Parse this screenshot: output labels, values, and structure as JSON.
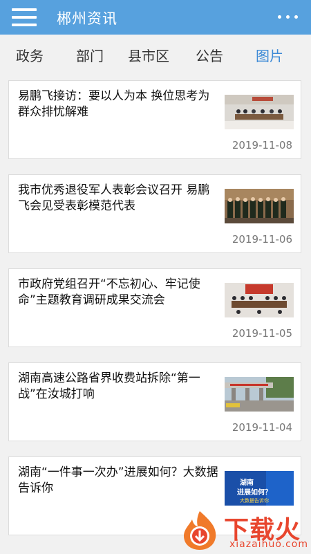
{
  "header": {
    "title": "郴州资讯",
    "menu_icon": "hamburger-icon",
    "more_icon": "more-dots-icon"
  },
  "tabs": [
    {
      "label": "政务",
      "active": false
    },
    {
      "label": "部门",
      "active": false
    },
    {
      "label": "县市区",
      "active": false
    },
    {
      "label": "公告",
      "active": false
    },
    {
      "label": "图片",
      "active": true
    }
  ],
  "articles": [
    {
      "title": "易鹏飞接访：要以人为本 换位思考为群众排忧解难",
      "date": "2019-11-08"
    },
    {
      "title": "我市优秀退役军人表彰会议召开 易鹏飞会见受表彰模范代表",
      "date": "2019-11-06"
    },
    {
      "title": "市政府党组召开“不忘初心、牢记使命”主题教育调研成果交流会",
      "date": "2019-11-05"
    },
    {
      "title": "湖南高速公路省界收费站拆除“第一战”在汝城打响",
      "date": "2019-11-04"
    },
    {
      "title": "湖南“一件事一次办”进展如何？大数据告诉你",
      "date": "",
      "thumb_text": "湖南 进展如何？ 大数据告诉你"
    }
  ],
  "watermark": {
    "logo": "下载火",
    "url": "xiazaihuo.com"
  },
  "colors": {
    "header": "#57a1de",
    "active_tab": "#3d8ad6",
    "background": "#f1f1f1",
    "logo": "#e8462e"
  }
}
